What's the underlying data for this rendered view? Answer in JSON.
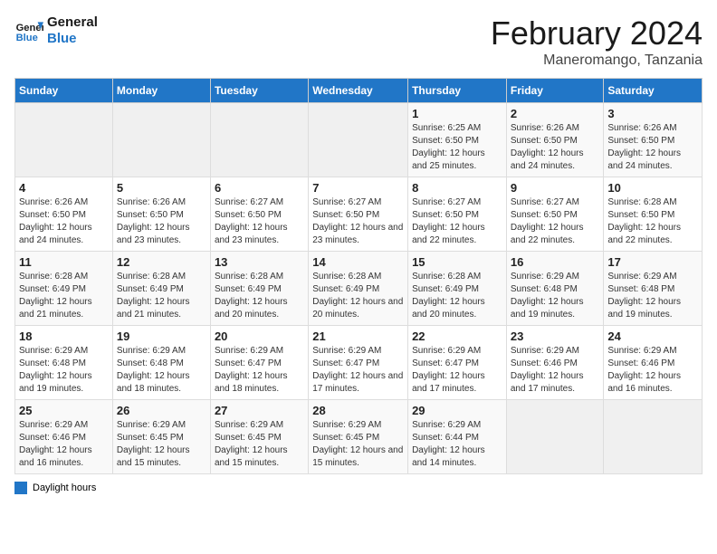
{
  "header": {
    "logo_line1": "General",
    "logo_line2": "Blue",
    "title": "February 2024",
    "subtitle": "Maneromango, Tanzania"
  },
  "legend": {
    "box_label": "Daylight hours"
  },
  "days_of_week": [
    "Sunday",
    "Monday",
    "Tuesday",
    "Wednesday",
    "Thursday",
    "Friday",
    "Saturday"
  ],
  "weeks": [
    {
      "days": [
        {
          "num": "",
          "info": ""
        },
        {
          "num": "",
          "info": ""
        },
        {
          "num": "",
          "info": ""
        },
        {
          "num": "",
          "info": ""
        },
        {
          "num": "1",
          "info": "Sunrise: 6:25 AM\nSunset: 6:50 PM\nDaylight: 12 hours and 25 minutes."
        },
        {
          "num": "2",
          "info": "Sunrise: 6:26 AM\nSunset: 6:50 PM\nDaylight: 12 hours and 24 minutes."
        },
        {
          "num": "3",
          "info": "Sunrise: 6:26 AM\nSunset: 6:50 PM\nDaylight: 12 hours and 24 minutes."
        }
      ]
    },
    {
      "days": [
        {
          "num": "4",
          "info": "Sunrise: 6:26 AM\nSunset: 6:50 PM\nDaylight: 12 hours and 24 minutes."
        },
        {
          "num": "5",
          "info": "Sunrise: 6:26 AM\nSunset: 6:50 PM\nDaylight: 12 hours and 23 minutes."
        },
        {
          "num": "6",
          "info": "Sunrise: 6:27 AM\nSunset: 6:50 PM\nDaylight: 12 hours and 23 minutes."
        },
        {
          "num": "7",
          "info": "Sunrise: 6:27 AM\nSunset: 6:50 PM\nDaylight: 12 hours and 23 minutes."
        },
        {
          "num": "8",
          "info": "Sunrise: 6:27 AM\nSunset: 6:50 PM\nDaylight: 12 hours and 22 minutes."
        },
        {
          "num": "9",
          "info": "Sunrise: 6:27 AM\nSunset: 6:50 PM\nDaylight: 12 hours and 22 minutes."
        },
        {
          "num": "10",
          "info": "Sunrise: 6:28 AM\nSunset: 6:50 PM\nDaylight: 12 hours and 22 minutes."
        }
      ]
    },
    {
      "days": [
        {
          "num": "11",
          "info": "Sunrise: 6:28 AM\nSunset: 6:49 PM\nDaylight: 12 hours and 21 minutes."
        },
        {
          "num": "12",
          "info": "Sunrise: 6:28 AM\nSunset: 6:49 PM\nDaylight: 12 hours and 21 minutes."
        },
        {
          "num": "13",
          "info": "Sunrise: 6:28 AM\nSunset: 6:49 PM\nDaylight: 12 hours and 20 minutes."
        },
        {
          "num": "14",
          "info": "Sunrise: 6:28 AM\nSunset: 6:49 PM\nDaylight: 12 hours and 20 minutes."
        },
        {
          "num": "15",
          "info": "Sunrise: 6:28 AM\nSunset: 6:49 PM\nDaylight: 12 hours and 20 minutes."
        },
        {
          "num": "16",
          "info": "Sunrise: 6:29 AM\nSunset: 6:48 PM\nDaylight: 12 hours and 19 minutes."
        },
        {
          "num": "17",
          "info": "Sunrise: 6:29 AM\nSunset: 6:48 PM\nDaylight: 12 hours and 19 minutes."
        }
      ]
    },
    {
      "days": [
        {
          "num": "18",
          "info": "Sunrise: 6:29 AM\nSunset: 6:48 PM\nDaylight: 12 hours and 19 minutes."
        },
        {
          "num": "19",
          "info": "Sunrise: 6:29 AM\nSunset: 6:48 PM\nDaylight: 12 hours and 18 minutes."
        },
        {
          "num": "20",
          "info": "Sunrise: 6:29 AM\nSunset: 6:47 PM\nDaylight: 12 hours and 18 minutes."
        },
        {
          "num": "21",
          "info": "Sunrise: 6:29 AM\nSunset: 6:47 PM\nDaylight: 12 hours and 17 minutes."
        },
        {
          "num": "22",
          "info": "Sunrise: 6:29 AM\nSunset: 6:47 PM\nDaylight: 12 hours and 17 minutes."
        },
        {
          "num": "23",
          "info": "Sunrise: 6:29 AM\nSunset: 6:46 PM\nDaylight: 12 hours and 17 minutes."
        },
        {
          "num": "24",
          "info": "Sunrise: 6:29 AM\nSunset: 6:46 PM\nDaylight: 12 hours and 16 minutes."
        }
      ]
    },
    {
      "days": [
        {
          "num": "25",
          "info": "Sunrise: 6:29 AM\nSunset: 6:46 PM\nDaylight: 12 hours and 16 minutes."
        },
        {
          "num": "26",
          "info": "Sunrise: 6:29 AM\nSunset: 6:45 PM\nDaylight: 12 hours and 15 minutes."
        },
        {
          "num": "27",
          "info": "Sunrise: 6:29 AM\nSunset: 6:45 PM\nDaylight: 12 hours and 15 minutes."
        },
        {
          "num": "28",
          "info": "Sunrise: 6:29 AM\nSunset: 6:45 PM\nDaylight: 12 hours and 15 minutes."
        },
        {
          "num": "29",
          "info": "Sunrise: 6:29 AM\nSunset: 6:44 PM\nDaylight: 12 hours and 14 minutes."
        },
        {
          "num": "",
          "info": ""
        },
        {
          "num": "",
          "info": ""
        }
      ]
    }
  ]
}
